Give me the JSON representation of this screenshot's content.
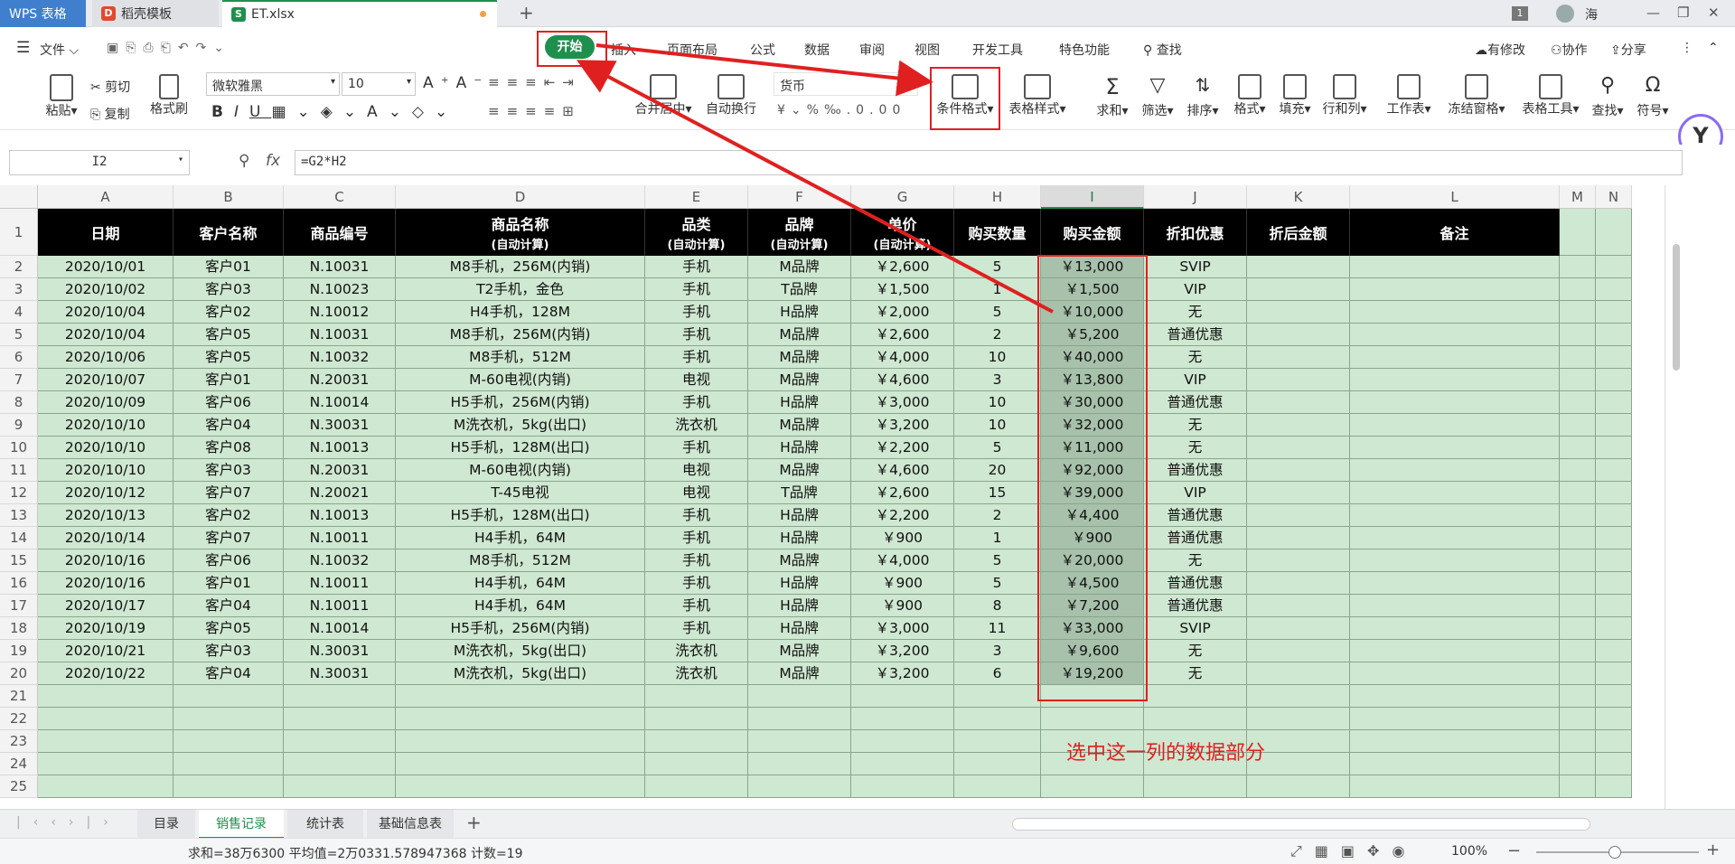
{
  "titlebar": {
    "app_tab": "WPS 表格",
    "tab2": "稻壳模板",
    "tab3": "ET.xlsx",
    "add": "+",
    "page_badge": "1",
    "user": "海"
  },
  "menubar": {
    "file_label": "文件",
    "tabs": [
      "开始",
      "插入",
      "页面布局",
      "公式",
      "数据",
      "审阅",
      "视图",
      "开发工具",
      "特色功能"
    ],
    "search": "查找",
    "right": [
      "有修改",
      "协作",
      "分享"
    ]
  },
  "ribbon": {
    "paste": "粘贴",
    "cut": "剪切",
    "copy": "复制",
    "format_painter": "格式刷",
    "font_name": "微软雅黑",
    "font_size": "10",
    "merge_center": "合并居中",
    "wrap_text": "自动换行",
    "number_format": "货币",
    "conditional_format": "条件格式",
    "table_style": "表格样式",
    "sum": "求和",
    "filter": "筛选",
    "sort": "排序",
    "format": "格式",
    "fill": "填充",
    "row_col": "行和列",
    "worksheet": "工作表",
    "freeze": "冻结窗格",
    "table_tools": "表格工具",
    "find": "查找",
    "symbol": "符号"
  },
  "formulabar": {
    "cell_ref": "I2",
    "fx": "fx",
    "formula": "=G2*H2"
  },
  "sheet": {
    "columns": [
      "A",
      "B",
      "C",
      "D",
      "E",
      "F",
      "G",
      "H",
      "I",
      "J",
      "K",
      "L",
      "M",
      "N"
    ],
    "header_row": [
      {
        "main": "日期",
        "sub": ""
      },
      {
        "main": "客户名称",
        "sub": ""
      },
      {
        "main": "商品编号",
        "sub": ""
      },
      {
        "main": "商品名称",
        "sub": "(自动计算)"
      },
      {
        "main": "品类",
        "sub": "(自动计算)"
      },
      {
        "main": "品牌",
        "sub": "(自动计算)"
      },
      {
        "main": "单价",
        "sub": "(自动计算)"
      },
      {
        "main": "购买数量",
        "sub": ""
      },
      {
        "main": "购买金额",
        "sub": ""
      },
      {
        "main": "折扣优惠",
        "sub": ""
      },
      {
        "main": "折后金额",
        "sub": ""
      },
      {
        "main": "备注",
        "sub": ""
      }
    ],
    "rows": [
      [
        "2020/10/01",
        "客户01",
        "N.10031",
        "M8手机，256M(内销)",
        "手机",
        "M品牌",
        "￥2,600",
        "5",
        "￥13,000",
        "SVIP"
      ],
      [
        "2020/10/02",
        "客户03",
        "N.10023",
        "T2手机，金色",
        "手机",
        "T品牌",
        "￥1,500",
        "1",
        "￥1,500",
        "VIP"
      ],
      [
        "2020/10/04",
        "客户02",
        "N.10012",
        "H4手机，128M",
        "手机",
        "H品牌",
        "￥2,000",
        "5",
        "￥10,000",
        "无"
      ],
      [
        "2020/10/04",
        "客户05",
        "N.10031",
        "M8手机，256M(内销)",
        "手机",
        "M品牌",
        "￥2,600",
        "2",
        "￥5,200",
        "普通优惠"
      ],
      [
        "2020/10/06",
        "客户05",
        "N.10032",
        "M8手机，512M",
        "手机",
        "M品牌",
        "￥4,000",
        "10",
        "￥40,000",
        "无"
      ],
      [
        "2020/10/07",
        "客户01",
        "N.20031",
        "M-60电视(内销)",
        "电视",
        "M品牌",
        "￥4,600",
        "3",
        "￥13,800",
        "VIP"
      ],
      [
        "2020/10/09",
        "客户06",
        "N.10014",
        "H5手机，256M(内销)",
        "手机",
        "H品牌",
        "￥3,000",
        "10",
        "￥30,000",
        "普通优惠"
      ],
      [
        "2020/10/10",
        "客户04",
        "N.30031",
        "M洗衣机，5kg(出口)",
        "洗衣机",
        "M品牌",
        "￥3,200",
        "10",
        "￥32,000",
        "无"
      ],
      [
        "2020/10/10",
        "客户08",
        "N.10013",
        "H5手机，128M(出口)",
        "手机",
        "H品牌",
        "￥2,200",
        "5",
        "￥11,000",
        "无"
      ],
      [
        "2020/10/10",
        "客户03",
        "N.20031",
        "M-60电视(内销)",
        "电视",
        "M品牌",
        "￥4,600",
        "20",
        "￥92,000",
        "普通优惠"
      ],
      [
        "2020/10/12",
        "客户07",
        "N.20021",
        "T-45电视",
        "电视",
        "T品牌",
        "￥2,600",
        "15",
        "￥39,000",
        "VIP"
      ],
      [
        "2020/10/13",
        "客户02",
        "N.10013",
        "H5手机，128M(出口)",
        "手机",
        "H品牌",
        "￥2,200",
        "2",
        "￥4,400",
        "普通优惠"
      ],
      [
        "2020/10/14",
        "客户07",
        "N.10011",
        "H4手机，64M",
        "手机",
        "H品牌",
        "￥900",
        "1",
        "￥900",
        "普通优惠"
      ],
      [
        "2020/10/16",
        "客户06",
        "N.10032",
        "M8手机，512M",
        "手机",
        "M品牌",
        "￥4,000",
        "5",
        "￥20,000",
        "无"
      ],
      [
        "2020/10/16",
        "客户01",
        "N.10011",
        "H4手机，64M",
        "手机",
        "H品牌",
        "￥900",
        "5",
        "￥4,500",
        "普通优惠"
      ],
      [
        "2020/10/17",
        "客户04",
        "N.10011",
        "H4手机，64M",
        "手机",
        "H品牌",
        "￥900",
        "8",
        "￥7,200",
        "普通优惠"
      ],
      [
        "2020/10/19",
        "客户05",
        "N.10014",
        "H5手机，256M(内销)",
        "手机",
        "H品牌",
        "￥3,000",
        "11",
        "￥33,000",
        "SVIP"
      ],
      [
        "2020/10/21",
        "客户03",
        "N.30031",
        "M洗衣机，5kg(出口)",
        "洗衣机",
        "M品牌",
        "￥3,200",
        "3",
        "￥9,600",
        "无"
      ],
      [
        "2020/10/22",
        "客户04",
        "N.30031",
        "M洗衣机，5kg(出口)",
        "洗衣机",
        "M品牌",
        "￥3,200",
        "6",
        "￥19,200",
        "无"
      ]
    ],
    "row_numbers": [
      "1",
      "2",
      "3",
      "4",
      "5",
      "6",
      "7",
      "8",
      "9",
      "10",
      "11",
      "12",
      "13",
      "14",
      "15",
      "16",
      "17",
      "18",
      "19",
      "20",
      "21",
      "22",
      "23",
      "24",
      "25"
    ]
  },
  "annotation": "选中这一列的数据部分",
  "sheettabs": [
    "目录",
    "销售记录",
    "统计表",
    "基础信息表"
  ],
  "statusbar": {
    "summary": "求和=38万6300  平均值=2万0331.578947368  计数=19",
    "zoom": "100%"
  },
  "colors": {
    "accent_green": "#1f8f4e",
    "cell_green": "#cfe8d1",
    "selection": "#a7c1aa",
    "annotation_red": "#e02020"
  }
}
